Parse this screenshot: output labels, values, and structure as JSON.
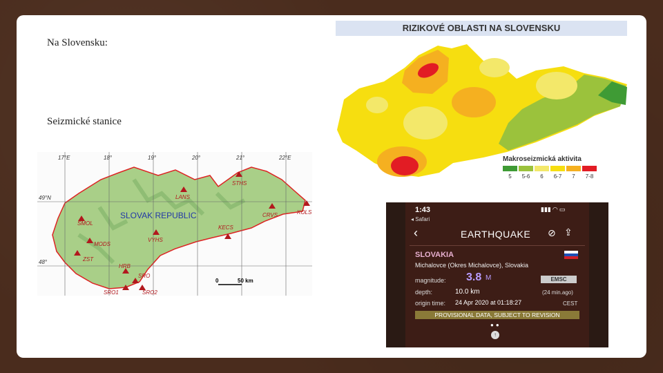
{
  "slide": {
    "heading1": "Na Slovensku:",
    "heading2": "Seizmické stanice"
  },
  "station_map": {
    "longitudes": [
      "17°E",
      "18°",
      "19°",
      "20°",
      "21°",
      "22°E"
    ],
    "latitudes": [
      "49°N",
      "48°"
    ],
    "country_label": "SLOVAK REPUBLIC",
    "stations": [
      "STHS",
      "LANS",
      "CRVS",
      "KOLS",
      "KECS",
      "SMOL",
      "MODS",
      "VYHS",
      "ZST",
      "HRB",
      "SRO",
      "SRO1",
      "SRO2"
    ],
    "scale_text": "50 km",
    "scale_zero": "0"
  },
  "risk_map": {
    "title": "RIZIKOVÉ OBLASTI NA SLOVENSKU",
    "legend_title": "Makroseizmická aktivita",
    "legend": [
      {
        "label": "5",
        "color": "#3f9b35"
      },
      {
        "label": "5-6",
        "color": "#9bc23c"
      },
      {
        "label": "6",
        "color": "#f3e86a"
      },
      {
        "label": "6-7",
        "color": "#f6de10"
      },
      {
        "label": "7",
        "color": "#f5b020"
      },
      {
        "label": "7-8",
        "color": "#e21c24"
      }
    ]
  },
  "phone": {
    "time": "1:43",
    "back_label": "◂ Safari",
    "title": "EARTHQUAKE",
    "country": "SLOVAKIA",
    "place": "Michalovce (Okres Michalovce), Slovakia",
    "magnitude_label": "magnitude:",
    "magnitude_value": "3.8",
    "magnitude_unit": "M",
    "source": "EMSC",
    "depth_label": "depth:",
    "depth_value": "10.0 km",
    "ago": "(24 min.ago)",
    "origin_label": "origin time:",
    "origin_value": "24 Apr 2020 at 01:18:27",
    "tz": "CEST",
    "notice": "PROVISIONAL DATA, SUBJECT TO REVISION"
  }
}
